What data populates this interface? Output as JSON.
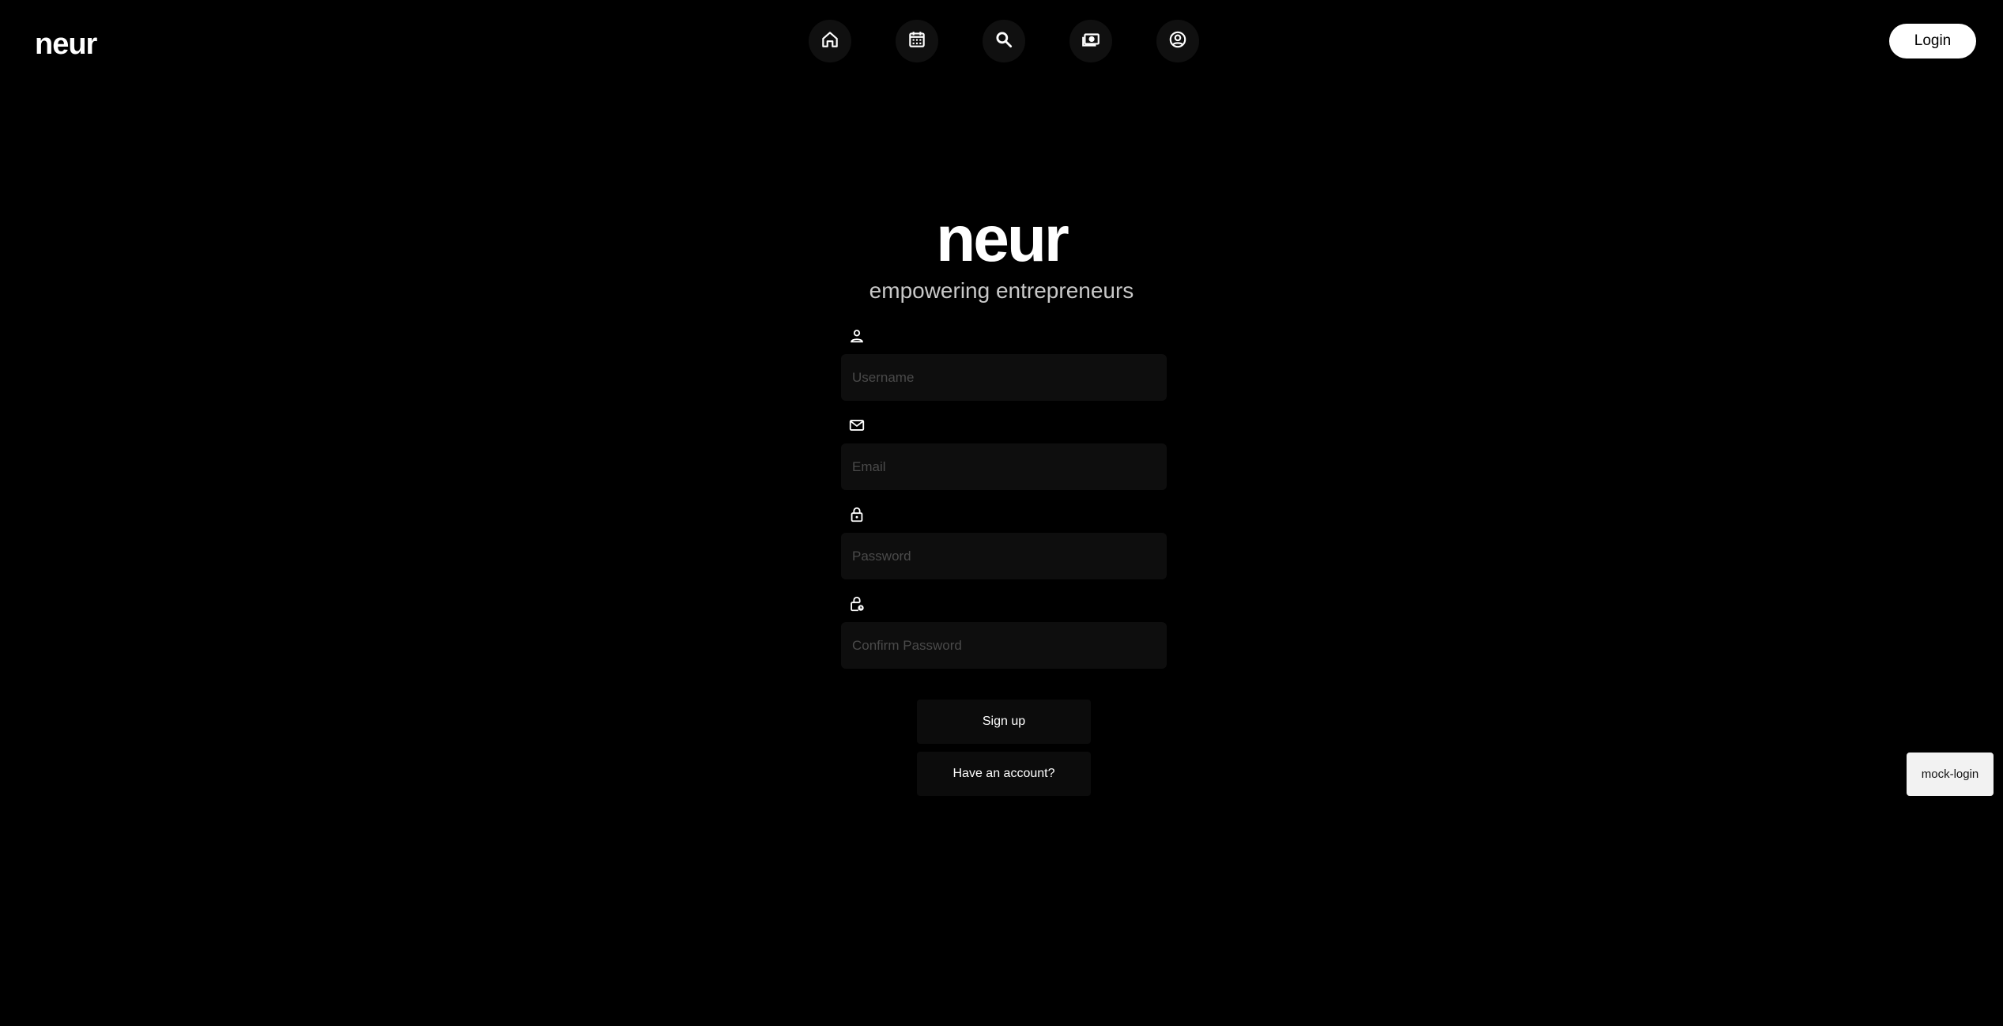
{
  "header": {
    "brand": "neur",
    "nav": [
      {
        "icon": "home-icon"
      },
      {
        "icon": "calendar-icon"
      },
      {
        "icon": "search-icon"
      },
      {
        "icon": "money-icon"
      },
      {
        "icon": "account-icon"
      }
    ],
    "login_label": "Login"
  },
  "hero": {
    "logo": "neur",
    "tagline": "empowering entrepreneurs"
  },
  "form": {
    "username": {
      "placeholder": "Username",
      "value": "",
      "icon": "person-icon"
    },
    "email": {
      "placeholder": "Email",
      "value": "",
      "icon": "mail-icon"
    },
    "password": {
      "placeholder": "Password",
      "value": "",
      "icon": "lock-icon"
    },
    "confirm_password": {
      "placeholder": "Confirm Password",
      "value": "",
      "icon": "lock-clock-icon"
    }
  },
  "actions": {
    "signup_label": "Sign up",
    "have_account_label": "Have an account?"
  },
  "dev": {
    "mock_login_label": "mock-login"
  },
  "colors": {
    "background": "#000000",
    "surface": "#0e0e0e",
    "text": "#ffffff",
    "placeholder": "#4a4a4a"
  }
}
